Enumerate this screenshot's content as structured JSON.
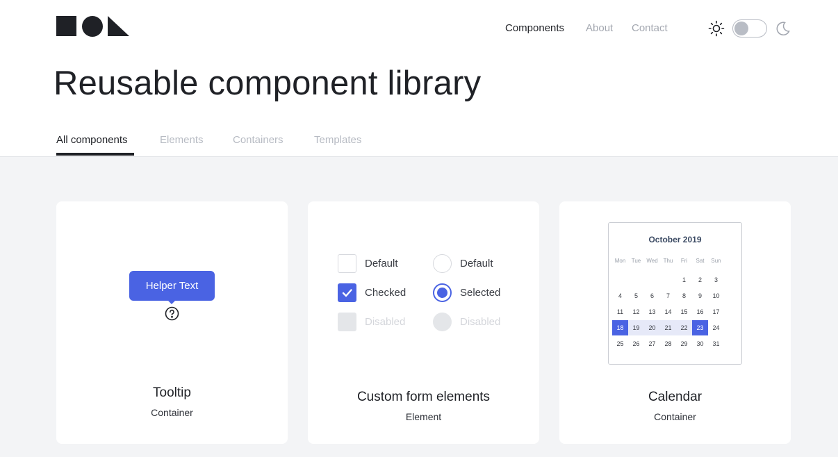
{
  "nav": {
    "components": "Components",
    "about": "About",
    "contact": "Contact"
  },
  "theme_toggle": {
    "state": "light"
  },
  "page": {
    "title": "Reusable component library"
  },
  "tabs": [
    {
      "label": "All components",
      "active": true
    },
    {
      "label": "Elements",
      "active": false
    },
    {
      "label": "Containers",
      "active": false
    },
    {
      "label": "Templates",
      "active": false
    }
  ],
  "cards": {
    "tooltip": {
      "helper_text": "Helper Text",
      "title": "Tooltip",
      "type": "Container"
    },
    "form": {
      "title": "Custom form elements",
      "type": "Element",
      "checkbox_default": "Default",
      "checkbox_checked": "Checked",
      "checkbox_disabled": "Disabled",
      "radio_default": "Default",
      "radio_selected": "Selected",
      "radio_disabled": "Disabled"
    },
    "calendar": {
      "title": "Calendar",
      "type": "Container",
      "month": "October 2019",
      "weekdays": [
        "Mon",
        "Tue",
        "Wed",
        "Thu",
        "Fri",
        "Sat",
        "Sun"
      ],
      "range_start": 18,
      "range_end": 23
    }
  },
  "colors": {
    "accent": "#4a63e3",
    "text": "#1f2126",
    "muted": "#a3a7b0",
    "background": "#f3f4f6"
  }
}
